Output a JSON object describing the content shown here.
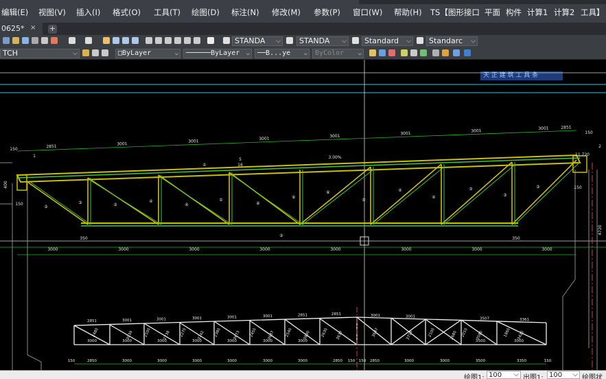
{
  "menu": [
    "编辑(E)",
    "视图(V)",
    "插入(I)",
    "格式(O)",
    "工具(T)",
    "绘图(D)",
    "标注(N)",
    "修改(M)",
    "参数(P)",
    "窗口(W)",
    "帮助(H)",
    "TS【图形接口",
    "平面",
    "构件",
    "计算1",
    "计算2",
    "工具】"
  ],
  "tab": {
    "label": "0625*",
    "close": "×",
    "add": "+"
  },
  "toolbar": {
    "text_style_1": "STANDA",
    "text_style_2": "STANDA",
    "dim_style": "Standard",
    "table_style": "Standarc",
    "tianzheng_label": "天 正 建 筑 工 具 条"
  },
  "layers": {
    "current_layer": "TCH",
    "color": "ByLayer",
    "linetype": "ByLayer",
    "lineweight": "B...ye",
    "plot_style": "ByColor"
  },
  "drawing": {
    "top_segments": [
      "2851",
      "3001",
      "3001",
      "3001",
      "3001",
      "3001",
      "3001",
      "3001",
      "2851"
    ],
    "end_dims": [
      "150",
      "150",
      "150"
    ],
    "slope": "3.00%",
    "elevation": "11.720",
    "bottom_spans": [
      "3000",
      "3000",
      "3000",
      "3000",
      "3000",
      "3000",
      "3000",
      "3000"
    ],
    "support_dim": "350",
    "side_dims": [
      "400",
      "150",
      "4720"
    ],
    "member_tags": [
      "①",
      "②",
      "③",
      "④",
      "⑤",
      "⑥",
      "⑧"
    ],
    "section_marks": [
      "5",
      "16",
      "1",
      "2"
    ],
    "lower_top_dims": [
      "2851",
      "3001",
      "3001",
      "3001",
      "3001",
      "3001",
      "2851",
      "2851",
      "3001",
      "3001",
      "3507",
      "3361"
    ],
    "lower_diag_dims": [
      "2480",
      "3039",
      "2100",
      "2738",
      "2270",
      "3742",
      "2380",
      "3673",
      "2450",
      "3637",
      "2540",
      "3890",
      "2630",
      "3637",
      "3647",
      "3714",
      "2100",
      "2680",
      "2010",
      "3580",
      "1860",
      "3420"
    ],
    "lower_bottom_dims": [
      "3000",
      "3000",
      "3000",
      "3000",
      "3000",
      "3000",
      "3000",
      "3500",
      "3000"
    ],
    "lower_base_dims": [
      "150",
      "2850",
      "3000",
      "3000",
      "3000",
      "3000",
      "3000",
      "3000",
      "2850",
      "150",
      "150",
      "2850",
      "3000",
      "3000",
      "3500",
      "3350",
      "150"
    ]
  },
  "status": {
    "draw_scale_label": "绘图1:",
    "draw_scale": "100",
    "out_scale_label": "出图1:",
    "out_scale": "100",
    "mode_label": "绘图状"
  },
  "colors": {
    "truss_yellow": "#c8c000",
    "truss_green": "#3ec63e",
    "dims_green": "#1fb81f",
    "cyan_line": "#1fd0e0"
  }
}
